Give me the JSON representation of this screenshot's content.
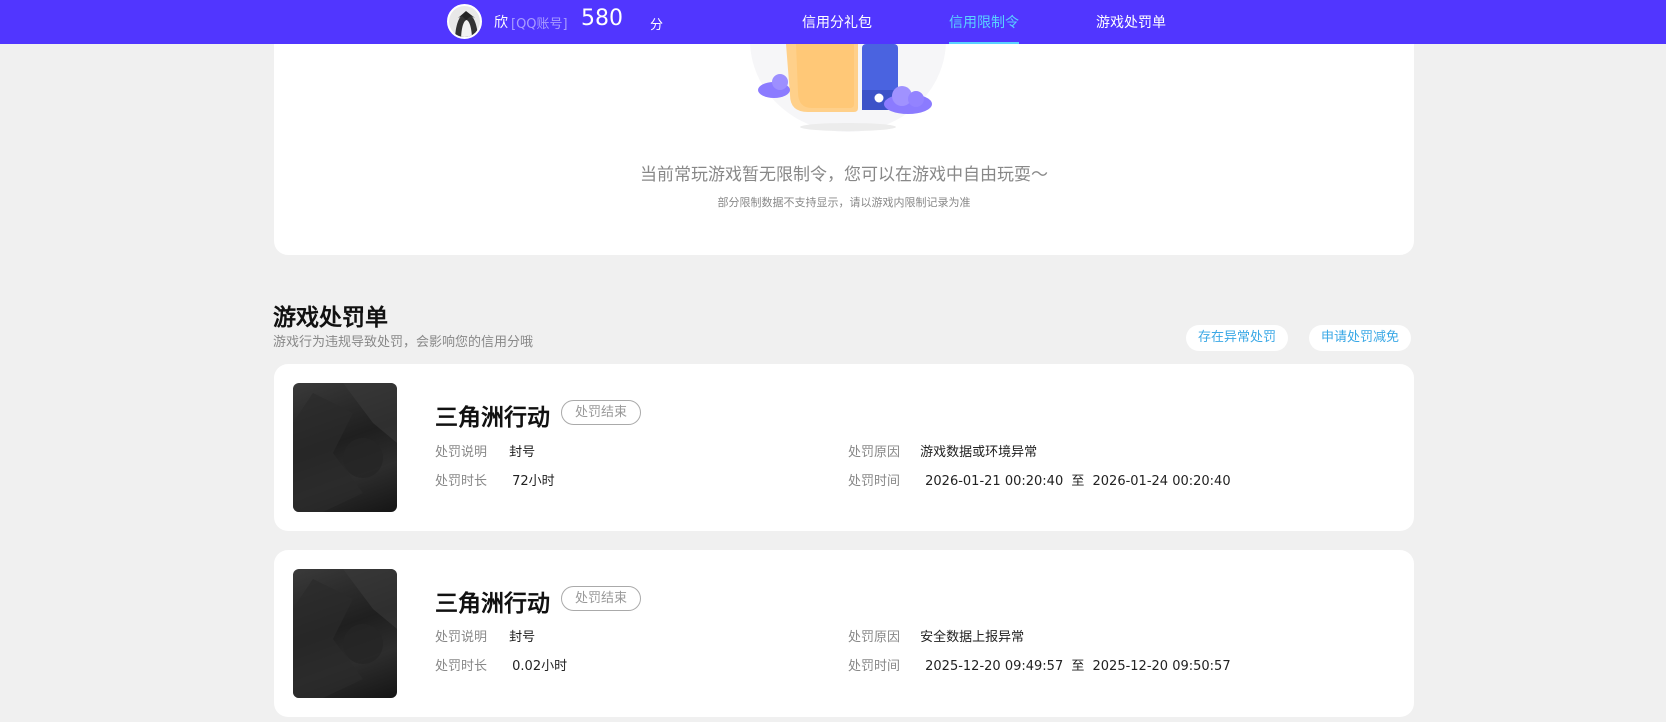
{
  "user": {
    "name": "欣",
    "account_type": "[QQ账号]",
    "score": "580",
    "score_unit": "分"
  },
  "nav": {
    "tabs": [
      {
        "label": "信用分礼包"
      },
      {
        "label": "信用限制令"
      },
      {
        "label": "游戏处罚单"
      }
    ],
    "active_index": 1
  },
  "restriction": {
    "empty_title": "当前常玩游戏暂无限制令，您可以在游戏中自由玩耍～",
    "empty_sub": "部分限制数据不支持显示，请以游戏内限制记录为准"
  },
  "punishment": {
    "title": "游戏处罚单",
    "subtitle": "游戏行为违规导致处罚，会影响您的信用分哦",
    "actions": {
      "report_abnormal": "存在异常处罚",
      "apply_reduction": "申请处罚减免"
    },
    "labels": {
      "desc": "处罚说明",
      "duration": "处罚时长",
      "reason": "处罚原因",
      "time": "处罚时间",
      "to": "至"
    },
    "items": [
      {
        "game": "三角洲行动",
        "status": "处罚结束",
        "desc": "封号",
        "duration": "72小时",
        "reason": "游戏数据或环境异常",
        "start": "2026-01-21 00:20:40",
        "end": "2026-01-24 00:20:40"
      },
      {
        "game": "三角洲行动",
        "status": "处罚结束",
        "desc": "封号",
        "duration": "0.02小时",
        "reason": "安全数据上报异常",
        "start": "2025-12-20 09:49:57",
        "end": "2025-12-20 09:50:57"
      }
    ]
  },
  "colors": {
    "topbar": "#5136ff",
    "active_tab": "#5ad2ff",
    "link": "#3aa8e6",
    "background": "#f0f0f0"
  }
}
